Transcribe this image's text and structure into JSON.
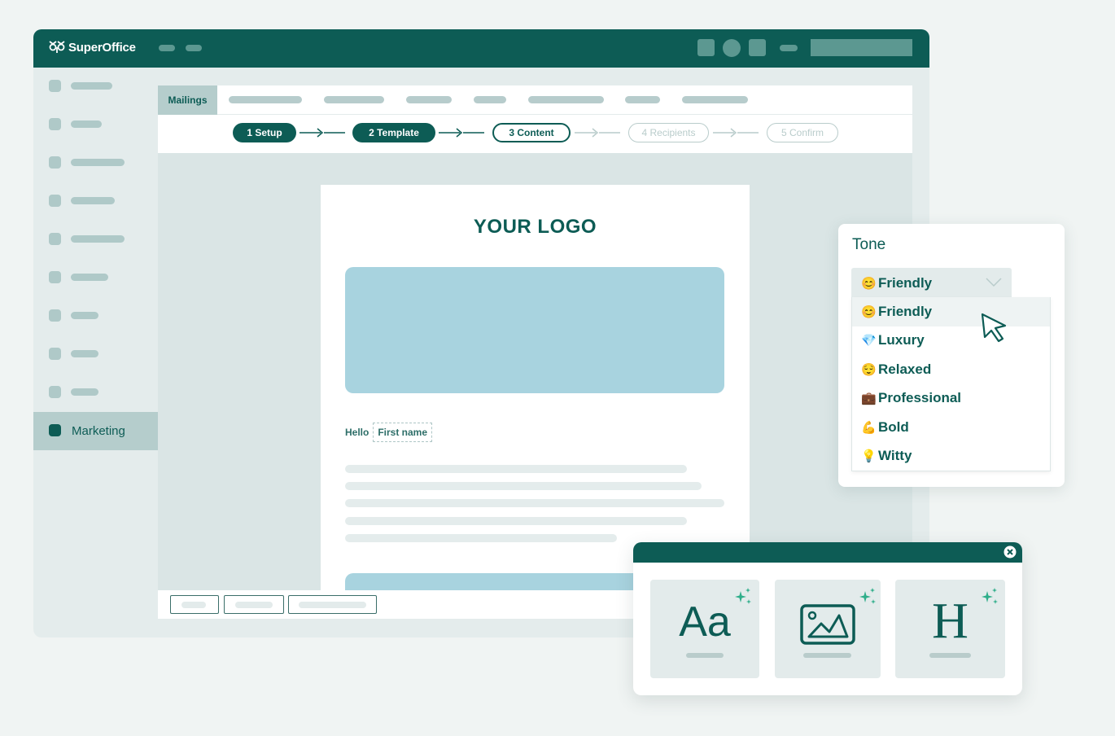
{
  "app": {
    "brand_name": "SuperOffice",
    "brand_icon": "owl-logo-icon"
  },
  "sidebar": {
    "items": [
      {
        "label": "",
        "icon": "placeholder-icon"
      },
      {
        "label": "",
        "icon": "placeholder-icon"
      },
      {
        "label": "",
        "icon": "placeholder-icon"
      },
      {
        "label": "",
        "icon": "placeholder-icon"
      },
      {
        "label": "",
        "icon": "placeholder-icon"
      },
      {
        "label": "",
        "icon": "placeholder-icon"
      },
      {
        "label": "",
        "icon": "placeholder-icon"
      },
      {
        "label": "",
        "icon": "placeholder-icon"
      },
      {
        "label": "",
        "icon": "placeholder-icon"
      },
      {
        "label": "Marketing",
        "icon": "marketing-icon",
        "active": true
      }
    ]
  },
  "tabs": {
    "active_label": "Mailings"
  },
  "wizard": {
    "steps": [
      {
        "label": "1 Setup",
        "state": "done"
      },
      {
        "label": "2 Template",
        "state": "done"
      },
      {
        "label": "3 Content",
        "state": "current"
      },
      {
        "label": "4 Recipients",
        "state": "future"
      },
      {
        "label": "5 Confirm",
        "state": "future"
      }
    ]
  },
  "email": {
    "logo_text": "YOUR LOGO",
    "greeting": "Hello",
    "merge_field": "First name"
  },
  "tone": {
    "title": "Tone",
    "selected": {
      "emoji": "😊",
      "label": "Friendly"
    },
    "options": [
      {
        "emoji": "😊",
        "label": "Friendly",
        "hovered": true
      },
      {
        "emoji": "💎",
        "label": "Luxury"
      },
      {
        "emoji": "😌",
        "label": "Relaxed"
      },
      {
        "emoji": "💼",
        "label": "Professional"
      },
      {
        "emoji": "💪",
        "label": "Bold"
      },
      {
        "emoji": "💡",
        "label": "Witty"
      }
    ]
  },
  "ai_tools": {
    "cards": [
      {
        "glyph": "Aa",
        "name": "text-style",
        "icon": "typography-icon"
      },
      {
        "glyph": "",
        "name": "image",
        "icon": "image-icon"
      },
      {
        "glyph": "H",
        "name": "heading",
        "icon": "heading-icon"
      }
    ]
  },
  "colors": {
    "brand": "#0d5c55",
    "accent_sparkle": "#2fae8a",
    "image_placeholder": "#a8d3df"
  }
}
